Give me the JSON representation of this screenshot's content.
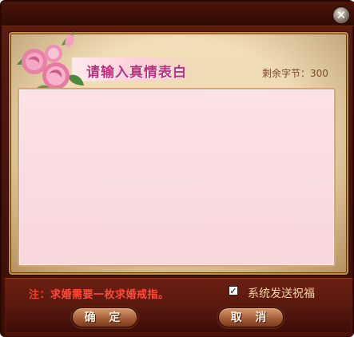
{
  "dialog": {
    "title": "请输入真情表白",
    "remaining_bytes": "剩余字节：300",
    "message_value": "",
    "note_prefix": "注：",
    "note_text": "求婚需要一枚求婚戒指。",
    "send_blessing": {
      "label": "系统发送祝福",
      "checked": true
    },
    "confirm_label": "确 定",
    "cancel_label": "取 消",
    "close_icon": "close-icon",
    "decoration_icon": "rose-icon"
  }
}
